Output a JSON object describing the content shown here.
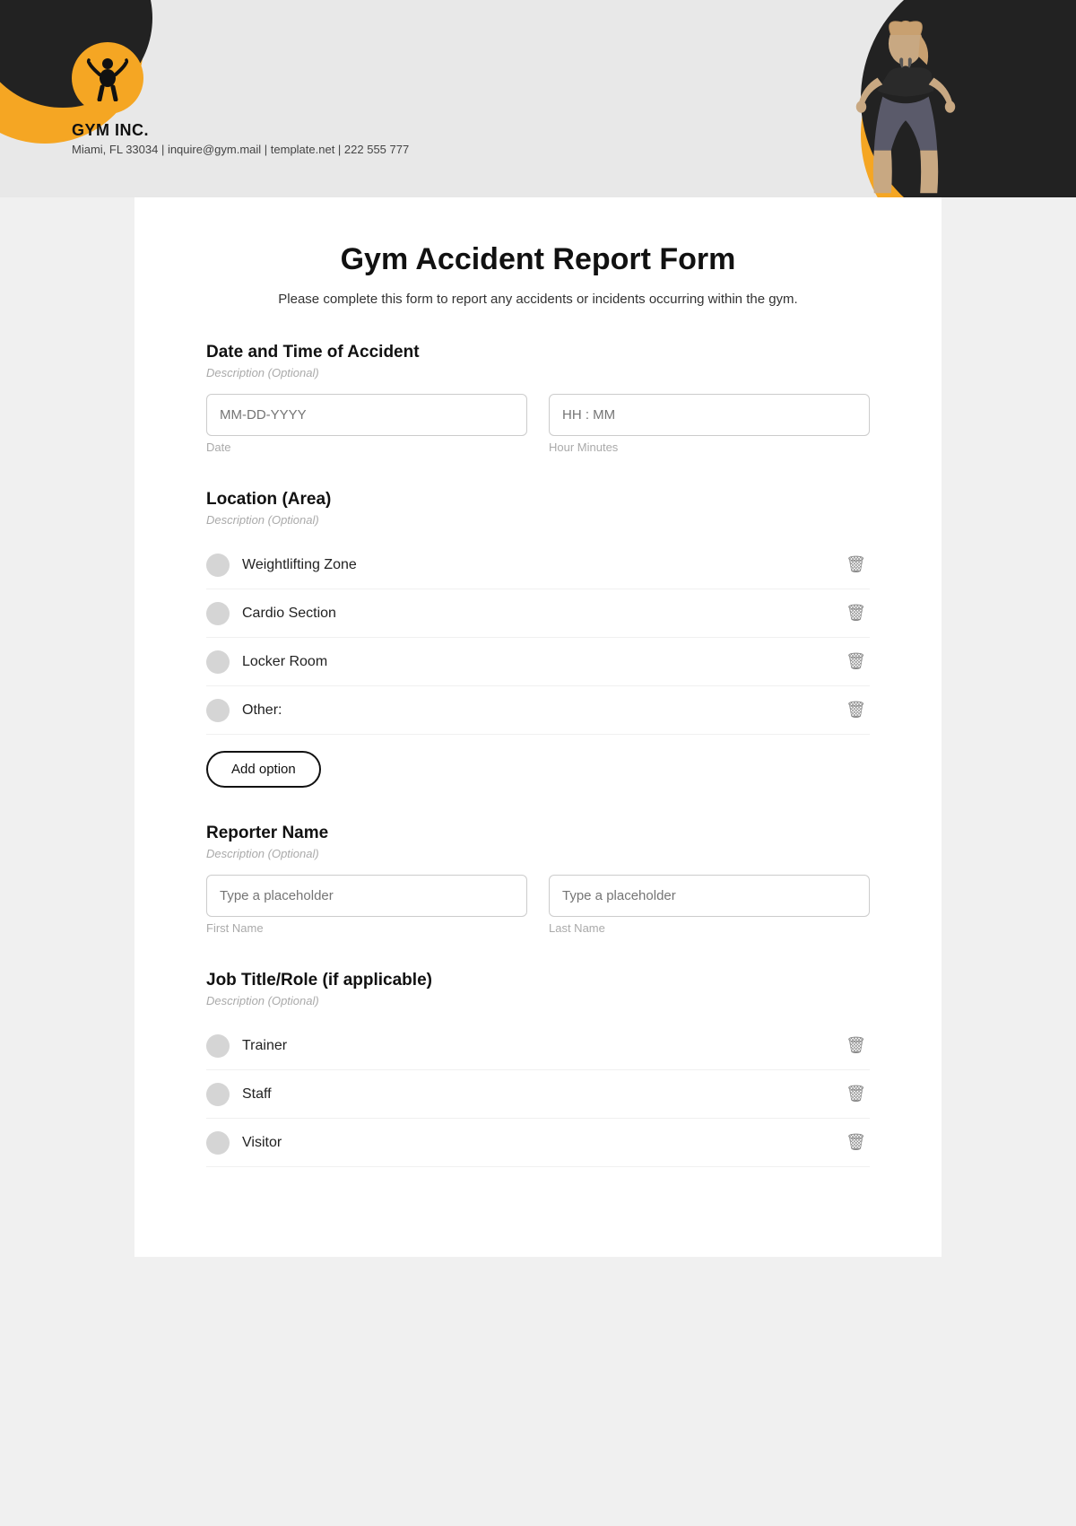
{
  "header": {
    "gym_name": "GYM INC.",
    "gym_info": "Miami, FL 33034 | inquire@gym.mail | template.net | 222 555 777"
  },
  "form": {
    "title": "Gym Accident Report Form",
    "subtitle": "Please complete this form to report any accidents or incidents occurring within the gym.",
    "sections": [
      {
        "id": "date_time",
        "title": "Date and Time of Accident",
        "description": "Description (Optional)",
        "fields": [
          {
            "placeholder": "MM-DD-YYYY",
            "label": "Date"
          },
          {
            "placeholder": "HH : MM",
            "label": "Hour Minutes"
          }
        ]
      },
      {
        "id": "location",
        "title": "Location (Area)",
        "description": "Description (Optional)",
        "options": [
          "Weightlifting Zone",
          "Cardio Section",
          "Locker Room",
          "Other:"
        ],
        "add_option_label": "Add option"
      },
      {
        "id": "reporter_name",
        "title": "Reporter Name",
        "description": "Description (Optional)",
        "fields": [
          {
            "placeholder": "Type a placeholder",
            "label": "First Name"
          },
          {
            "placeholder": "Type a placeholder",
            "label": "Last Name"
          }
        ]
      },
      {
        "id": "job_title",
        "title": "Job Title/Role (if applicable)",
        "description": "Description (Optional)",
        "options": [
          "Trainer",
          "Staff",
          "Visitor"
        ]
      }
    ]
  }
}
